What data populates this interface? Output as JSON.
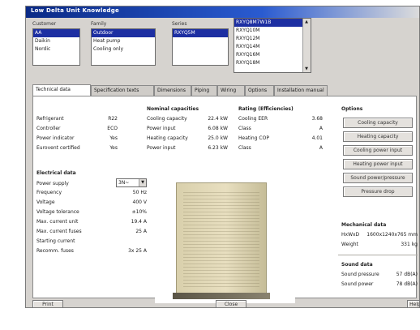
{
  "window": {
    "title": "Low Delta Unit Knowledge"
  },
  "selectors": {
    "type": {
      "label": "Customer",
      "items": [
        "AA",
        "Daikin",
        "Nordic"
      ],
      "selected": 0
    },
    "model": {
      "label": "Family",
      "items": [
        "Outdoor",
        "Heat pump",
        "Cooling only"
      ],
      "selected": 0
    },
    "series": {
      "label": "Series",
      "items": [
        "RXYQ5M"
      ],
      "selected": 0
    },
    "variant": {
      "label": "",
      "items": [
        "RXYQ8M7W1B",
        "RXYQ10M",
        "RXYQ12M",
        "RXYQ14M",
        "RXYQ16M",
        "RXYQ18M"
      ],
      "selected": 0
    }
  },
  "tabs": [
    "Technical data",
    "Specification texts",
    "Dimensions",
    "Piping",
    "Wiring",
    "Options",
    "Installation manual"
  ],
  "general": {
    "rows": [
      {
        "k": "Refrigerant",
        "v": "R22"
      },
      {
        "k": "Controller",
        "v": "ECO"
      },
      {
        "k": "Power indicator",
        "v": "Yes"
      },
      {
        "k": "Eurovent certified",
        "v": "Yes"
      }
    ]
  },
  "nominal": {
    "title": "Nominal capacities",
    "rows": [
      {
        "k": "Cooling capacity",
        "v": "22.4 kW"
      },
      {
        "k": "Power input",
        "v": "6.08 kW"
      },
      {
        "k": "Heating capacity",
        "v": "25.0 kW"
      },
      {
        "k": "Power input",
        "v": "6.23 kW"
      }
    ]
  },
  "rating": {
    "title": "Rating (Efficiencies)",
    "rows": [
      {
        "k": "Cooling EER",
        "v": "3.68"
      },
      {
        "k": "Class",
        "v": "A"
      },
      {
        "k": "Heating COP",
        "v": "4.01"
      },
      {
        "k": "Class",
        "v": "A"
      }
    ]
  },
  "electrical": {
    "title": "Electrical data",
    "supply_label": "Power supply",
    "supply_value": "3N~",
    "rows": [
      {
        "k": "Frequency",
        "v": "50 Hz"
      },
      {
        "k": "Voltage",
        "v": "400 V"
      },
      {
        "k": "Voltage tolerance",
        "v": "±10%"
      },
      {
        "k": "Max. current unit",
        "v": "19.4 A"
      },
      {
        "k": "Max. current fuses",
        "v": "25 A"
      },
      {
        "k": "Starting current",
        "v": ""
      },
      {
        "k": "Recomm. fuses",
        "v": "3x 25 A"
      }
    ]
  },
  "options_panel": {
    "title": "Options",
    "buttons": [
      "Cooling capacity",
      "Heating capacity",
      "Cooling power input",
      "Heating power input",
      "Sound power/pressure",
      "Pressure drop"
    ]
  },
  "mechanical": {
    "title": "Mechanical data",
    "rows": [
      {
        "k": "HxWxD",
        "v": "1600x1240x765 mm"
      },
      {
        "k": "Weight",
        "v": "331 kg"
      }
    ]
  },
  "sound": {
    "title": "Sound data",
    "rows": [
      {
        "k": "Sound pressure",
        "v": "57 dB(A)"
      },
      {
        "k": "Sound power",
        "v": "78 dB(A)"
      }
    ]
  },
  "footer": {
    "left": "Print",
    "center": "Close",
    "right": "Help"
  }
}
